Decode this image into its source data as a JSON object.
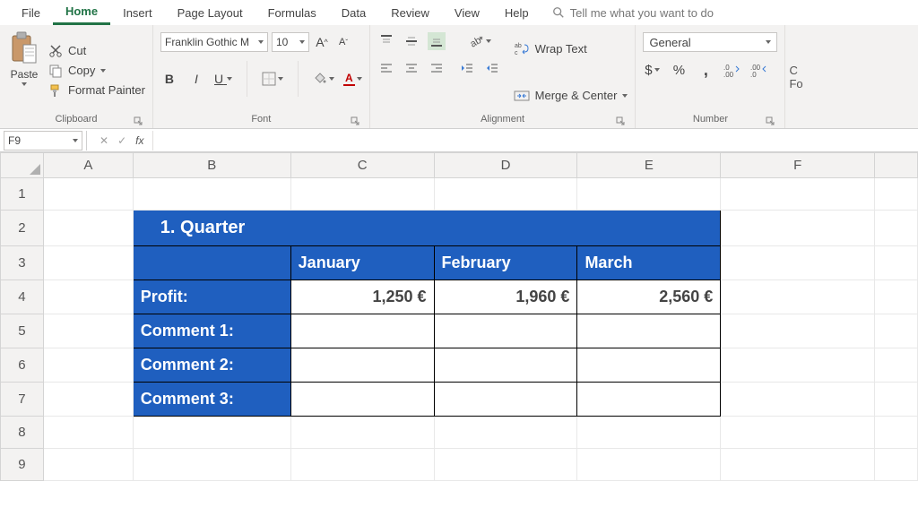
{
  "tabs": [
    "File",
    "Home",
    "Insert",
    "Page Layout",
    "Formulas",
    "Data",
    "Review",
    "View",
    "Help"
  ],
  "active_tab_index": 1,
  "tellme": "Tell me what you want to do",
  "clipboard": {
    "paste": "Paste",
    "cut": "Cut",
    "copy": "Copy",
    "format_painter": "Format Painter",
    "group": "Clipboard"
  },
  "font": {
    "name": "Franklin Gothic M",
    "size": "10",
    "bold": "B",
    "italic": "I",
    "underline": "U",
    "group": "Font"
  },
  "alignment": {
    "wrap": "Wrap Text",
    "merge": "Merge & Center",
    "group": "Alignment"
  },
  "number": {
    "format": "General",
    "group": "Number"
  },
  "namebox": "F9",
  "columns": [
    "A",
    "B",
    "C",
    "D",
    "E",
    "F"
  ],
  "rows": [
    "1",
    "2",
    "3",
    "4",
    "5",
    "6",
    "7",
    "8",
    "9"
  ],
  "sheet": {
    "title": "1. Quarter",
    "months": [
      "January",
      "February",
      "March"
    ],
    "row_profit_label": "Profit:",
    "row_profit": [
      "1,250 €",
      "1,960 €",
      "2,560 €"
    ],
    "row_c1": "Comment 1:",
    "row_c2": "Comment 2:",
    "row_c3": "Comment 3:"
  }
}
